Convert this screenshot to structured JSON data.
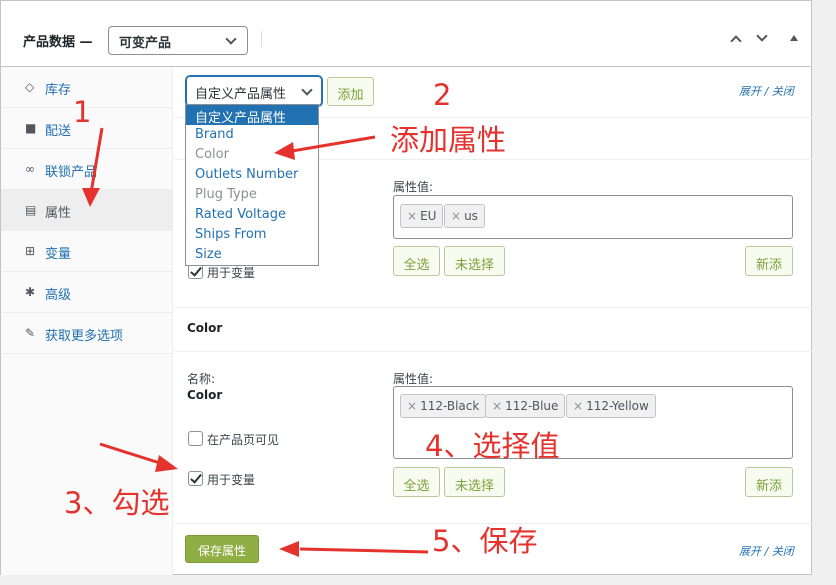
{
  "header": {
    "title": "产品数据 —",
    "product_type": "可变产品"
  },
  "sidebar": {
    "items": [
      {
        "label": "库存",
        "icon": "tag-icon"
      },
      {
        "label": "配送",
        "icon": "truck-icon"
      },
      {
        "label": "联锁产品",
        "icon": "link-icon"
      },
      {
        "label": "属性",
        "icon": "list-icon"
      },
      {
        "label": "变量",
        "icon": "grid-icon"
      },
      {
        "label": "高级",
        "icon": "gear-icon"
      },
      {
        "label": "获取更多选项",
        "icon": "plugin-icon"
      }
    ]
  },
  "toolbar": {
    "attribute_select": "自定义产品属性",
    "add_button": "添加",
    "expand_collapse": "展开 / 关闭"
  },
  "dropdown": {
    "options": [
      "自定义产品属性",
      "Brand",
      "Color",
      "Outlets Number",
      "Plug Type",
      "Rated Voltage",
      "Ships From",
      "Size"
    ]
  },
  "attr1": {
    "values_label": "属性值:",
    "values": [
      "EU",
      "us"
    ],
    "use_for_variations": "用于变量",
    "select_all": "全选",
    "select_none": "未选择",
    "add_new": "新添"
  },
  "attr2": {
    "heading": "Color",
    "name_label": "名称:",
    "name_value": "Color",
    "values_label": "属性值:",
    "values": [
      "112-Black",
      "112-Blue",
      "112-Yellow"
    ],
    "visible_on_page": "在产品页可见",
    "use_for_variations": "用于变量",
    "select_all": "全选",
    "select_none": "未选择",
    "add_new": "新添"
  },
  "footer": {
    "save_button": "保存属性",
    "expand_collapse": "展开 / 关闭"
  },
  "annotations": {
    "a1": "1",
    "a2": "2",
    "a2_text": "添加属性",
    "a3": "3、勾选",
    "a4": "4、选择值",
    "a5": "5、保存"
  },
  "colors": {
    "accent": "#2271b1",
    "save_green": "#8fae43",
    "annotation_red": "#e5322d"
  }
}
